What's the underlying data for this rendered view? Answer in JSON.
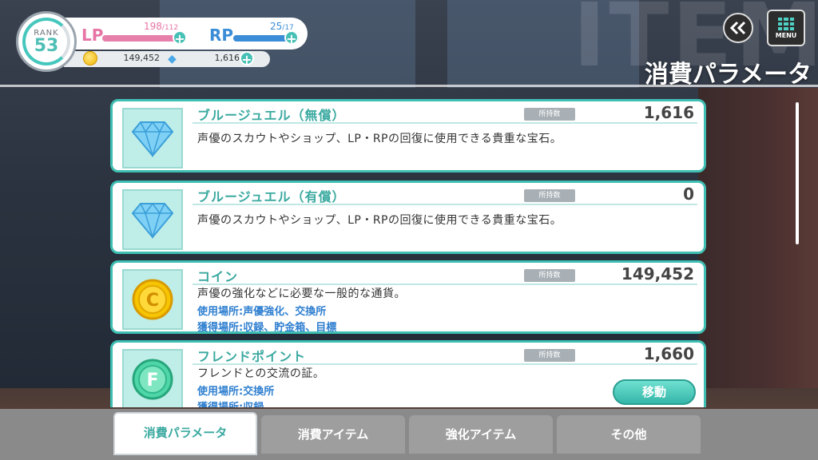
{
  "status": {
    "rank_label": "RANK",
    "rank_value": "53",
    "lp_label": "LP",
    "lp_current": "198",
    "lp_max": "/112",
    "lp_fill": 1.0,
    "rp_label": "RP",
    "rp_current": "25",
    "rp_max": "/17",
    "rp_fill": 1.0,
    "coins": "149,452",
    "jewels": "1,616"
  },
  "header": {
    "watermark": "ITEM",
    "back_icon": "double-chevron-left-icon",
    "menu_label": "MENU",
    "page_title": "消費パラメータ"
  },
  "items": [
    {
      "name": "ブルージュエル（無償）",
      "badge": "所持数",
      "count": "1,616",
      "icon": "blue-jewel-icon",
      "desc": "声優のスカウトやショップ、LP・RPの回復に使用できる貴重な宝石。"
    },
    {
      "name": "ブルージュエル（有償）",
      "badge": "所持数",
      "count": "0",
      "icon": "blue-jewel-icon",
      "desc": "声優のスカウトやショップ、LP・RPの回復に使用できる貴重な宝石。"
    },
    {
      "name": "コイン",
      "badge": "所持数",
      "count": "149,452",
      "icon": "coin-icon",
      "desc": "声優の強化などに必要な一般的な通貨。",
      "use": "使用場所:声優強化、交換所",
      "get": "獲得場所:収録、貯金箱、目標"
    },
    {
      "name": "フレンドポイント",
      "badge": "所持数",
      "count": "1,660",
      "icon": "friend-point-icon",
      "desc": "フレンドとの交流の証。",
      "use": "使用場所:交換所",
      "get": "獲得場所:収録",
      "button": "移動"
    }
  ],
  "tabs": [
    {
      "label": "消費パラメータ",
      "active": true
    },
    {
      "label": "消費アイテム",
      "active": false
    },
    {
      "label": "強化アイテム",
      "active": false
    },
    {
      "label": "その他",
      "active": false
    }
  ],
  "colors": {
    "accent": "#3fbfb3",
    "lp": "#e675a6",
    "rp": "#3a8dd6"
  }
}
